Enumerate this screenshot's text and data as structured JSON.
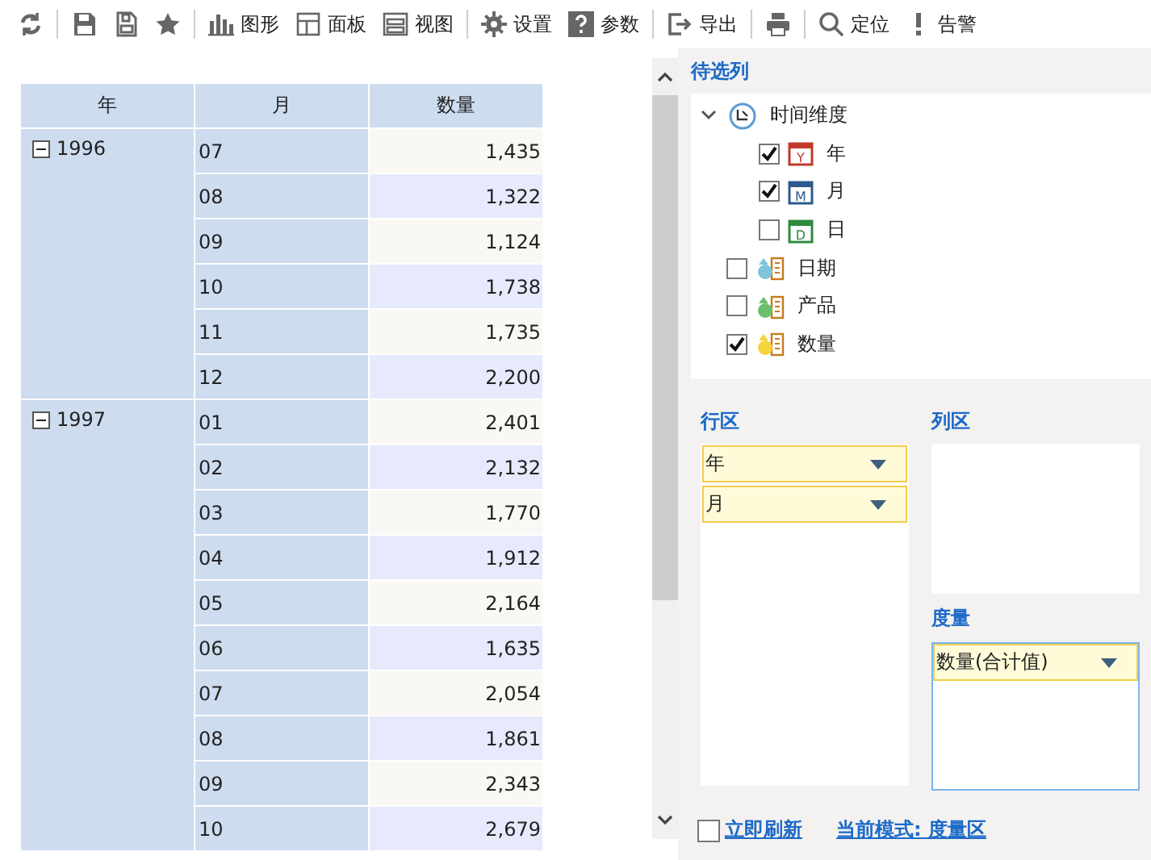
{
  "toolbar": [
    [
      {
        "kind": "refresh"
      }
    ],
    [
      {
        "kind": "save"
      },
      {
        "kind": "save-as"
      },
      {
        "kind": "star"
      }
    ],
    [
      {
        "kind": "chart",
        "label": "图形"
      },
      {
        "kind": "panel",
        "label": "面板"
      },
      {
        "kind": "view",
        "label": "视图"
      }
    ],
    [
      {
        "kind": "settings",
        "label": "设置"
      },
      {
        "kind": "param",
        "label": "参数"
      }
    ],
    [
      {
        "kind": "export",
        "label": "导出"
      }
    ],
    [
      {
        "kind": "print"
      }
    ],
    [
      {
        "kind": "locate",
        "label": "定位"
      },
      {
        "kind": "alert",
        "label": "告警"
      }
    ]
  ],
  "table": {
    "columns": [
      "年",
      "月",
      "数量"
    ],
    "groups": [
      {
        "year": "1996",
        "expanded": true,
        "rows": [
          {
            "month": "07",
            "value": "1,435"
          },
          {
            "month": "08",
            "value": "1,322"
          },
          {
            "month": "09",
            "value": "1,124"
          },
          {
            "month": "10",
            "value": "1,738"
          },
          {
            "month": "11",
            "value": "1,735"
          },
          {
            "month": "12",
            "value": "2,200"
          }
        ]
      },
      {
        "year": "1997",
        "expanded": true,
        "rows": [
          {
            "month": "01",
            "value": "2,401"
          },
          {
            "month": "02",
            "value": "2,132"
          },
          {
            "month": "03",
            "value": "1,770"
          },
          {
            "month": "04",
            "value": "1,912"
          },
          {
            "month": "05",
            "value": "2,164"
          },
          {
            "month": "06",
            "value": "1,635"
          },
          {
            "month": "07",
            "value": "2,054"
          },
          {
            "month": "08",
            "value": "1,861"
          },
          {
            "month": "09",
            "value": "2,343"
          },
          {
            "month": "10",
            "value": "2,679"
          }
        ]
      }
    ]
  },
  "candidates": {
    "title": "待选列",
    "root": {
      "label": "时间维度",
      "expanded": true,
      "children": [
        {
          "label": "年",
          "checked": true,
          "badge": "Y",
          "color": "#c0392b"
        },
        {
          "label": "月",
          "checked": true,
          "badge": "M",
          "color": "#2c5a8c"
        },
        {
          "label": "日",
          "checked": false,
          "badge": "D",
          "color": "#2e8b3e"
        }
      ]
    },
    "items": [
      {
        "label": "日期",
        "checked": false,
        "color": "#7fc4d8"
      },
      {
        "label": "产品",
        "checked": false,
        "color": "#6cc06c"
      },
      {
        "label": "数量",
        "checked": true,
        "color": "#f5d33c"
      }
    ]
  },
  "zones": [
    {
      "title": "行区",
      "selected": false,
      "fields": [
        "年",
        "月"
      ]
    },
    {
      "title": "列区",
      "selected": false
    },
    {
      "title": "度量",
      "selected": true,
      "fields": [
        "数量(合计值)"
      ]
    }
  ],
  "footer": {
    "refresh": {
      "label": "立即刷新",
      "checked": false
    },
    "mode": "当前模式: 度量区"
  }
}
